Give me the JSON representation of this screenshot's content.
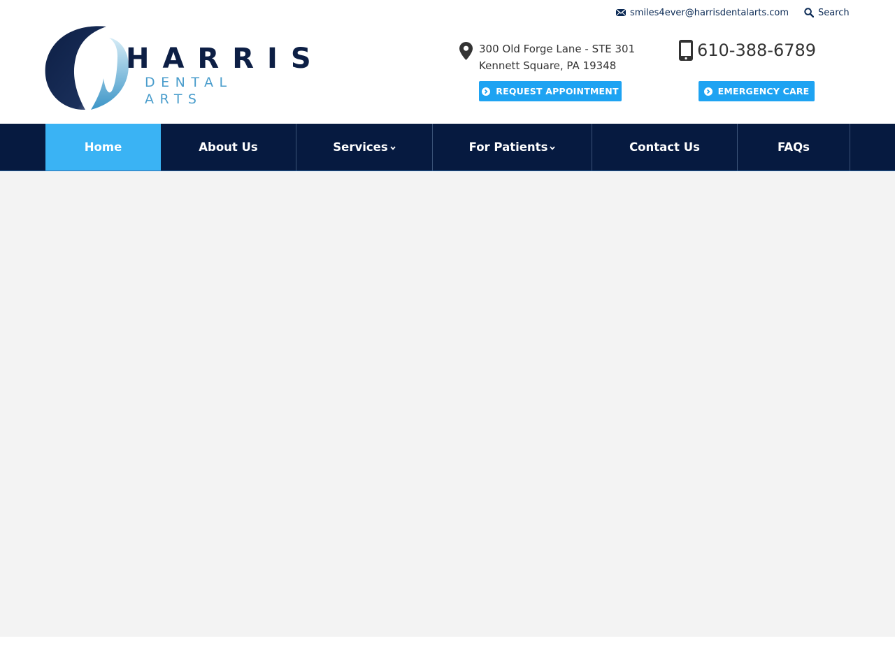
{
  "colors": {
    "navy": "#061a40",
    "accent_blue": "#1ea3f2",
    "nav_active": "#3ab3f4",
    "logo_light_blue": "#4a9dcc",
    "content_bg": "#f3f3f3"
  },
  "utility": {
    "email": "smiles4ever@harrisdentalarts.com",
    "email_icon": "envelope-icon",
    "search_label": "Search",
    "search_icon": "magnifier-icon"
  },
  "logo": {
    "word": "HARRIS",
    "sub": "DENTAL ARTS"
  },
  "contact": {
    "address_icon": "map-pin-icon",
    "address_line1": "300 Old Forge Lane - STE 301",
    "address_line2": "Kennett Square, PA 19348",
    "phone_icon": "mobile-phone-icon",
    "phone": "610-388-6789"
  },
  "buttons": {
    "request": "REQUEST APPOINTMENT",
    "emergency": "EMERGENCY CARE",
    "icon": "circle-chevron-right-icon"
  },
  "nav": {
    "items": [
      {
        "label": "Home",
        "active": true
      },
      {
        "label": "About Us"
      },
      {
        "label": "Services",
        "dropdown": true
      },
      {
        "label": "For Patients",
        "dropdown": true
      },
      {
        "label": "Contact Us"
      },
      {
        "label": "FAQs"
      }
    ]
  }
}
